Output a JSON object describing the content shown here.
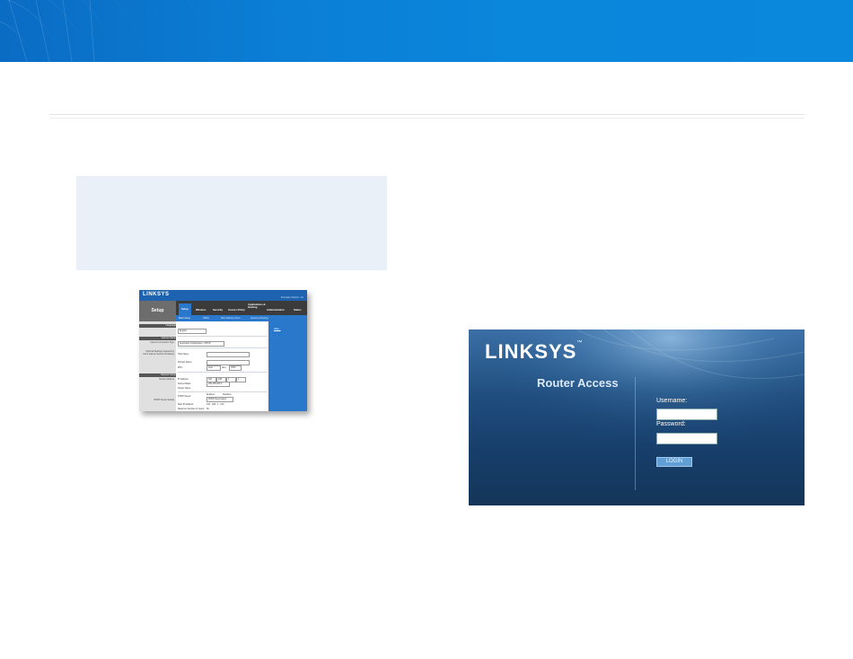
{
  "banner": {
    "accent": "#0b7fd6"
  },
  "note_box": {
    "color": "#eaf0f7"
  },
  "setup_screenshot": {
    "logo": "LINKSYS",
    "firmware": "Firmware Version: 1.0",
    "section": "Setup",
    "tabs": [
      "Setup",
      "Wireless",
      "Security",
      "Access Policy",
      "Applications & Gaming",
      "Administration",
      "Status"
    ],
    "subtabs": [
      "Basic Setup",
      "DDNS",
      "MAC Address Clone",
      "Advanced Routing"
    ],
    "sidebar": {
      "language": "Language",
      "internet_setup": "Internet Setup",
      "connection_type": "Internet Connection Type",
      "optional_settings": "Optional Settings (required by some Internet Service Providers)",
      "network_setup": "Network Setup",
      "router_address": "Router Address",
      "dhcp_setting": "DHCP Server Setting"
    },
    "main": {
      "language_value": "English",
      "connection_value": "Automatic Configuration - DHCP",
      "host_name": "Host Name:",
      "domain_name": "Domain Name:",
      "mtu": "MTU:",
      "mtu_mode": "Auto",
      "mtu_size_label": "Size:",
      "mtu_size": "1500",
      "ip_address": "IP Address:",
      "ip_values": [
        "192",
        "168",
        "1",
        "1"
      ],
      "subnet_mask": "Subnet Mask:",
      "subnet_value": "255.255.255.0",
      "router_name": "Router Name:",
      "dhcp_server": "DHCP Server:",
      "enabled": "Enabled",
      "disabled": "Disabled",
      "reservation": "DHCP Reservation",
      "start_ip": "Start IP Address:",
      "start_ip_value": "192 . 168 . 1 . 100",
      "max_users": "Maximum Number of Users:",
      "max_users_value": "50"
    },
    "help": "Help..."
  },
  "router_access": {
    "logo": "LINKSYS",
    "trademark": "™",
    "title": "Router Access",
    "username_label": "Username:",
    "username_value": "",
    "password_label": "Password:",
    "password_value": "",
    "login_button": "LOGIN"
  }
}
